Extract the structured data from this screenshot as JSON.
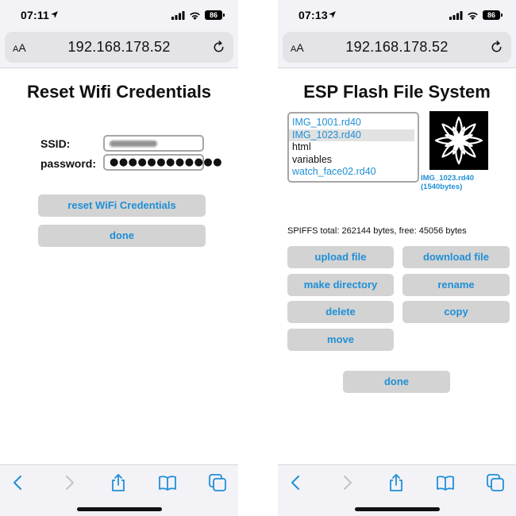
{
  "left": {
    "status": {
      "time": "07:11",
      "battery": "86"
    },
    "url": "192.168.178.52",
    "aa": "AA",
    "title": "Reset Wifi Credentials",
    "form": {
      "ssid_label": "SSID:",
      "password_label": "password:",
      "password_value": "●●●●●●●●●●●●"
    },
    "buttons": {
      "reset": "reset WiFi Credentials",
      "done": "done"
    }
  },
  "right": {
    "status": {
      "time": "07:13",
      "battery": "86"
    },
    "url": "192.168.178.52",
    "aa": "AA",
    "title": "ESP Flash File System",
    "files": [
      {
        "name": "IMG_1001.rd40",
        "link": true,
        "selected": false
      },
      {
        "name": "IMG_1023.rd40",
        "link": true,
        "selected": true
      },
      {
        "name": "html",
        "link": false,
        "selected": false
      },
      {
        "name": "variables",
        "link": false,
        "selected": false
      },
      {
        "name": "watch_face02.rd40",
        "link": true,
        "selected": false
      }
    ],
    "preview_caption": {
      "name": "IMG_1023.rd40",
      "size": "(1540bytes)"
    },
    "spiffs_info": "SPIFFS total: 262144 bytes, free: 45056 bytes",
    "buttons": {
      "upload": "upload file",
      "download": "download file",
      "mkdir": "make directory",
      "rename": "rename",
      "delete": "delete",
      "copy": "copy",
      "move": "move",
      "done": "done"
    }
  },
  "colors": {
    "accent": "#1f8fd6",
    "button_bg": "#d3d3d3",
    "bar_bg": "#f2f2f7"
  }
}
